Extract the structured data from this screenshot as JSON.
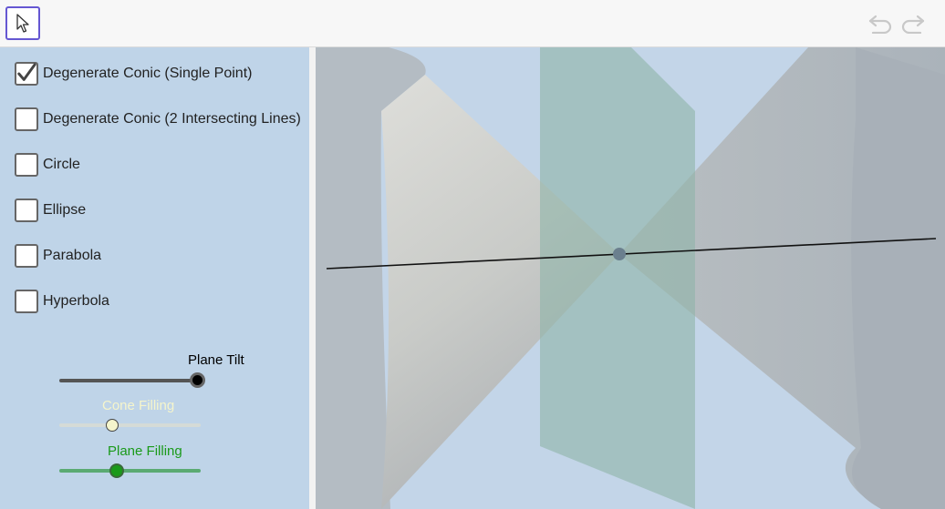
{
  "toolbar": {
    "move_tool_icon": "arrow-pointer-icon",
    "undo_icon": "undo-icon",
    "redo_icon": "redo-icon"
  },
  "checkboxes": [
    {
      "label": "Degenerate Conic (Single Point)",
      "checked": true
    },
    {
      "label": "Degenerate Conic (2 Intersecting Lines)",
      "checked": false
    },
    {
      "label": "Circle",
      "checked": false
    },
    {
      "label": "Ellipse",
      "checked": false
    },
    {
      "label": "Parabola",
      "checked": false
    },
    {
      "label": "Hyperbola",
      "checked": false
    }
  ],
  "sliders": {
    "plane_tilt": {
      "label": "Plane Tilt",
      "value_fraction": 1.0,
      "color": "#000000"
    },
    "cone_filling": {
      "label": "Cone Filling",
      "value_fraction": 0.37,
      "color": "#f5f5cc"
    },
    "plane_filling": {
      "label": "Plane Filling",
      "value_fraction": 0.41,
      "color": "#1a9a1a"
    }
  },
  "colors": {
    "accent": "#6557d2",
    "panel_bg": "#bfd4e8",
    "graphics_bg": "#c3d5e8"
  }
}
